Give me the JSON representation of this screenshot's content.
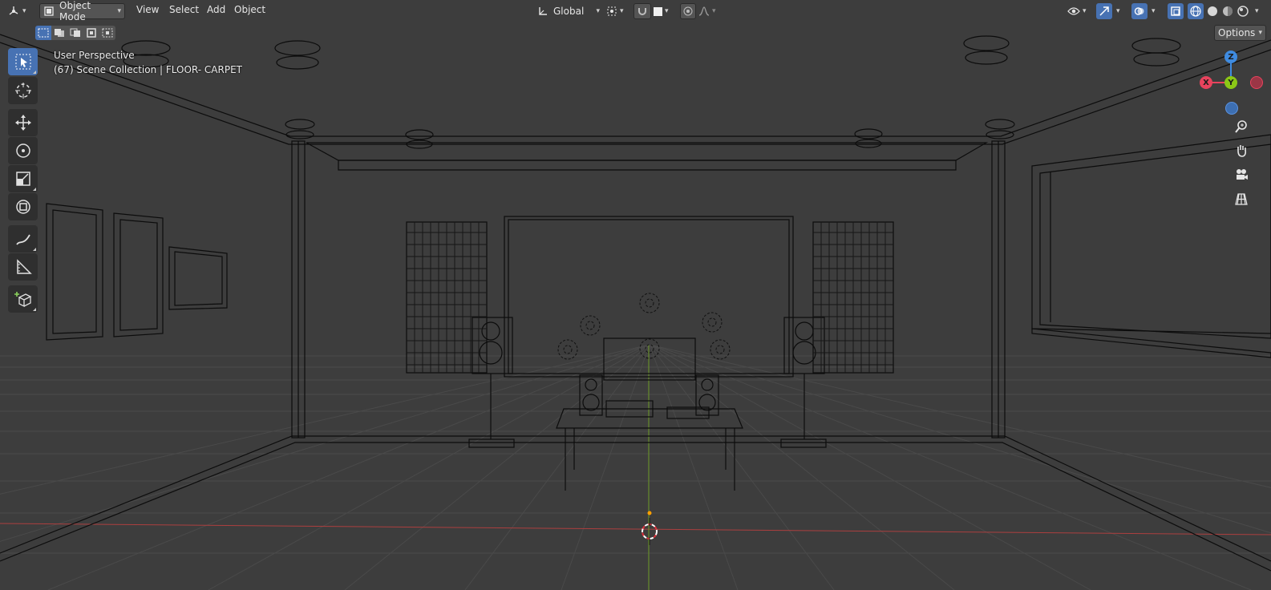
{
  "header": {
    "editor_type_icon": "3d-viewport-icon",
    "mode": {
      "label": "Object Mode",
      "icon": "object-mode-icon"
    },
    "menus": [
      "View",
      "Select",
      "Add",
      "Object"
    ],
    "transform_orientation": {
      "label": "Global",
      "icon": "orientation-icon"
    },
    "pivot_icon": "pivot-point-icon",
    "snap_icon": "snap-magnet-icon",
    "proportional_icon": "proportional-editing-icon",
    "falloff_icon": "falloff-curve-icon",
    "visibility_icon": "object-visibility-icon",
    "gizmo_icon": "viewport-gizmos-icon",
    "overlay_icon": "viewport-overlays-icon",
    "xray_icon": "toggle-xray-icon",
    "shading_icons": [
      "wireframe-shading-icon",
      "solid-shading-icon",
      "material-preview-icon",
      "rendered-shading-icon"
    ],
    "options_label": "Options"
  },
  "select_modes": [
    "select-new-icon",
    "select-extend-icon",
    "select-subtract-icon",
    "select-invert-icon",
    "select-intersect-icon"
  ],
  "overlay": {
    "view_name": "User Perspective",
    "collection_info": "(67) Scene Collection | FLOOR- CARPET"
  },
  "toolbar": [
    {
      "name": "select-box",
      "icon": "select-box-icon",
      "active": true
    },
    {
      "name": "cursor",
      "icon": "cursor-icon",
      "active": false
    },
    {
      "name": "move",
      "icon": "move-icon",
      "active": false
    },
    {
      "name": "rotate",
      "icon": "rotate-icon",
      "active": false
    },
    {
      "name": "scale",
      "icon": "scale-icon",
      "active": false
    },
    {
      "name": "transform",
      "icon": "transform-icon",
      "active": false
    },
    {
      "name": "annotate",
      "icon": "annotate-icon",
      "active": false
    },
    {
      "name": "measure",
      "icon": "measure-icon",
      "active": false
    },
    {
      "name": "add-cube",
      "icon": "add-cube-icon",
      "active": false
    }
  ],
  "navigation_gizmo": {
    "axes": [
      "Z",
      "X",
      "Y"
    ],
    "colors": {
      "x": "#e8435d",
      "y": "#8bc716",
      "z": "#3f8be0",
      "x_neg": "#9b3646",
      "z_neg": "#3d6fb2"
    }
  },
  "nav_buttons": [
    "zoom-icon",
    "pan-hand-icon",
    "camera-view-icon",
    "perspective-grid-icon"
  ],
  "colors": {
    "background": "#3d3d3d",
    "header": "#303030",
    "accent": "#4772b3",
    "wireframe": "#000000",
    "grid": "#4d4d4d",
    "x_axis": "#ac3f3f",
    "y_axis": "#6e9b29",
    "origin": "#ffa000"
  }
}
